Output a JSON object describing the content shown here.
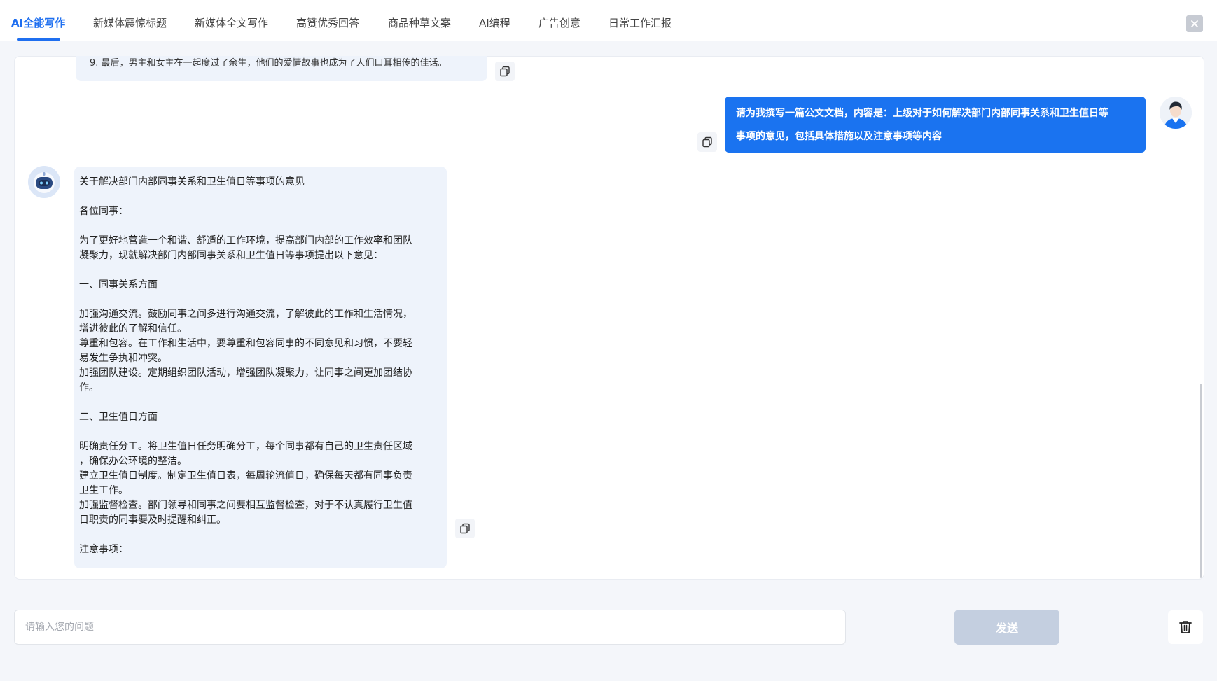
{
  "tabs": [
    {
      "label": "AI全能写作",
      "active": true
    },
    {
      "label": "新媒体震惊标题",
      "active": false
    },
    {
      "label": "新媒体全文写作",
      "active": false
    },
    {
      "label": "高赞优秀回答",
      "active": false
    },
    {
      "label": "商品种草文案",
      "active": false
    },
    {
      "label": "AI编程",
      "active": false
    },
    {
      "label": "广告创意",
      "active": false
    },
    {
      "label": "日常工作汇报",
      "active": false
    }
  ],
  "close_icon": "close-icon",
  "messages": {
    "prev_bot_tail": "9. 最后，男主和女主在一起度过了余生，他们的爱情故事也成为了人们口耳相传的佳话。",
    "user_message": {
      "line1": "请为我撰写一篇公文文档，内容是：上级对于如何解决部门内部同事关系和卫生值日等",
      "line2": "事项的意见，包括具体措施以及注意事项等内容"
    },
    "bot_reply": {
      "title": "关于解决部门内部同事关系和卫生值日等事项的意见",
      "greeting": "各位同事：",
      "intro_1": "为了更好地营造一个和谐、舒适的工作环境，提高部门内部的工作效率和团队",
      "intro_2": "凝聚力，现就解决部门内部同事关系和卫生值日等事项提出以下意见：",
      "section1_heading": "一、同事关系方面",
      "s1_l1": "加强沟通交流。鼓励同事之间多进行沟通交流，了解彼此的工作和生活情况，",
      "s1_l2": "增进彼此的了解和信任。",
      "s1_l3": "尊重和包容。在工作和生活中，要尊重和包容同事的不同意见和习惯，不要轻",
      "s1_l4": "易发生争执和冲突。",
      "s1_l5": "加强团队建设。定期组织团队活动，增强团队凝聚力，让同事之间更加团结协",
      "s1_l6": "作。",
      "section2_heading": "二、卫生值日方面",
      "s2_l1": "明确责任分工。将卫生值日任务明确分工，每个同事都有自己的卫生责任区域",
      "s2_l2": "，确保办公环境的整洁。",
      "s2_l3": "建立卫生值日制度。制定卫生值日表，每周轮流值日，确保每天都有同事负责",
      "s2_l4": "卫生工作。",
      "s2_l5": "加强监督检查。部门领导和同事之间要相互监督检查，对于不认真履行卫生值",
      "s2_l6": "日职责的同事要及时提醒和纠正。",
      "notes_heading": "注意事项："
    }
  },
  "input": {
    "placeholder": "请输入您的问题",
    "value": ""
  },
  "send_label": "发送",
  "colors": {
    "accent": "#1f6ff0",
    "user_bubble": "#1a73f0",
    "bot_bubble": "#eef3fb",
    "send_disabled": "#c4cfe0"
  }
}
